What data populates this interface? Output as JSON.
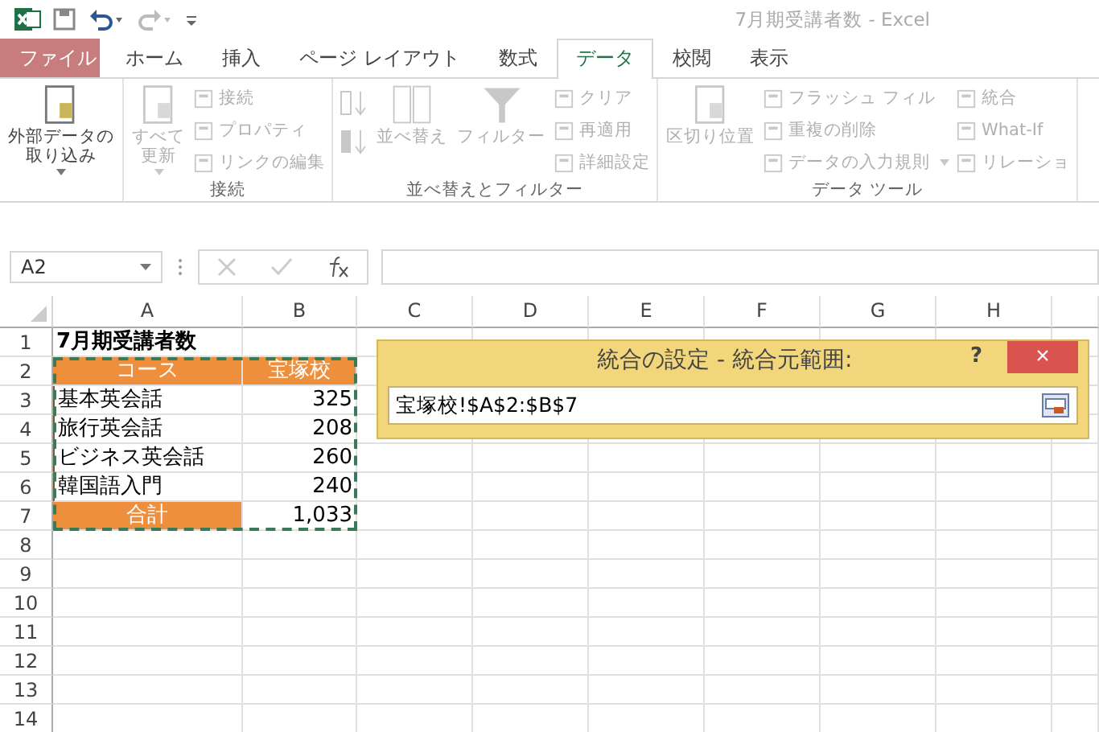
{
  "window": {
    "title": "7月期受講者数 - Excel"
  },
  "tabs": [
    {
      "label": "ファイル",
      "selected": false,
      "kind": "file"
    },
    {
      "label": "ホーム",
      "selected": false
    },
    {
      "label": "挿入",
      "selected": false
    },
    {
      "label": "ページ レイアウト",
      "selected": false
    },
    {
      "label": "数式",
      "selected": false
    },
    {
      "label": "データ",
      "selected": true
    },
    {
      "label": "校閲",
      "selected": false
    },
    {
      "label": "表示",
      "selected": false
    }
  ],
  "ribbon": {
    "groups": [
      {
        "items": [
          {
            "kind": "large",
            "label_lines": [
              "外部データの",
              "取り込み"
            ],
            "dropdown": true,
            "disabled": false
          }
        ]
      },
      {
        "label": "接続",
        "items": [
          {
            "kind": "large",
            "label_lines": [
              "すべて",
              "更新"
            ],
            "dropdown": true,
            "disabled": true
          },
          {
            "kind": "small",
            "label": "接続",
            "disabled": true
          },
          {
            "kind": "small",
            "label": "プロパティ",
            "disabled": true
          },
          {
            "kind": "small",
            "label": "リンクの編集",
            "disabled": true
          }
        ]
      },
      {
        "label": "並べ替えとフィルター",
        "items": [
          {
            "kind": "sortpair",
            "disabled": true
          },
          {
            "kind": "large",
            "label_lines": [
              "並べ替え"
            ],
            "disabled": true
          },
          {
            "kind": "large",
            "label_lines": [
              "フィルター"
            ],
            "disabled": true
          },
          {
            "kind": "small",
            "label": "クリア",
            "disabled": true
          },
          {
            "kind": "small",
            "label": "再適用",
            "disabled": true
          },
          {
            "kind": "small",
            "label": "詳細設定",
            "disabled": true
          }
        ]
      },
      {
        "label": "データ ツール",
        "items": [
          {
            "kind": "large",
            "label_lines": [
              "区切り位置"
            ],
            "disabled": true
          },
          {
            "kind": "small",
            "label": "フラッシュ フィル",
            "disabled": true
          },
          {
            "kind": "small",
            "label": "重複の削除",
            "disabled": true
          },
          {
            "kind": "small",
            "label": "データの入力規則",
            "dropdown": true,
            "disabled": true
          },
          {
            "kind": "small",
            "label": "統合",
            "disabled": true
          },
          {
            "kind": "small",
            "label": "What-If",
            "disabled": true
          },
          {
            "kind": "small",
            "label": "リレーショ",
            "disabled": true
          }
        ]
      }
    ]
  },
  "formula_bar": {
    "name_box": "A2"
  },
  "sheet": {
    "columns": [
      "A",
      "B",
      "C",
      "D",
      "E",
      "F",
      "G",
      "H"
    ],
    "copy_marquee": true,
    "rows": [
      {
        "number": "1",
        "cells": [
          {
            "kind": "title",
            "text": "7月期受講者数"
          }
        ]
      },
      {
        "number": "2",
        "cells": [
          {
            "kind": "header",
            "text": "コース"
          },
          {
            "kind": "header",
            "text": "宝塚校"
          }
        ]
      },
      {
        "number": "3",
        "cells": [
          {
            "kind": "text",
            "text": "基本英会話"
          },
          {
            "kind": "number",
            "text": "325"
          }
        ]
      },
      {
        "number": "4",
        "cells": [
          {
            "kind": "text",
            "text": "旅行英会話"
          },
          {
            "kind": "number",
            "text": "208"
          }
        ]
      },
      {
        "number": "5",
        "cells": [
          {
            "kind": "text",
            "text": "ビジネス英会話"
          },
          {
            "kind": "number",
            "text": "260"
          }
        ]
      },
      {
        "number": "6",
        "cells": [
          {
            "kind": "text",
            "text": "韓国語入門"
          },
          {
            "kind": "number",
            "text": "240"
          }
        ]
      },
      {
        "number": "7",
        "cells": [
          {
            "kind": "header",
            "text": "合計"
          },
          {
            "kind": "number",
            "text": "1,033"
          }
        ]
      },
      {
        "number": "8",
        "cells": []
      },
      {
        "number": "9",
        "cells": []
      },
      {
        "number": "10",
        "cells": []
      },
      {
        "number": "11",
        "cells": []
      },
      {
        "number": "12",
        "cells": []
      },
      {
        "number": "13",
        "cells": []
      },
      {
        "number": "14",
        "cells": []
      }
    ]
  },
  "dialog": {
    "title": "統合の設定 - 統合元範囲:",
    "help": "?",
    "close": "×",
    "value": "宝塚校!$A$2:$B$7"
  }
}
